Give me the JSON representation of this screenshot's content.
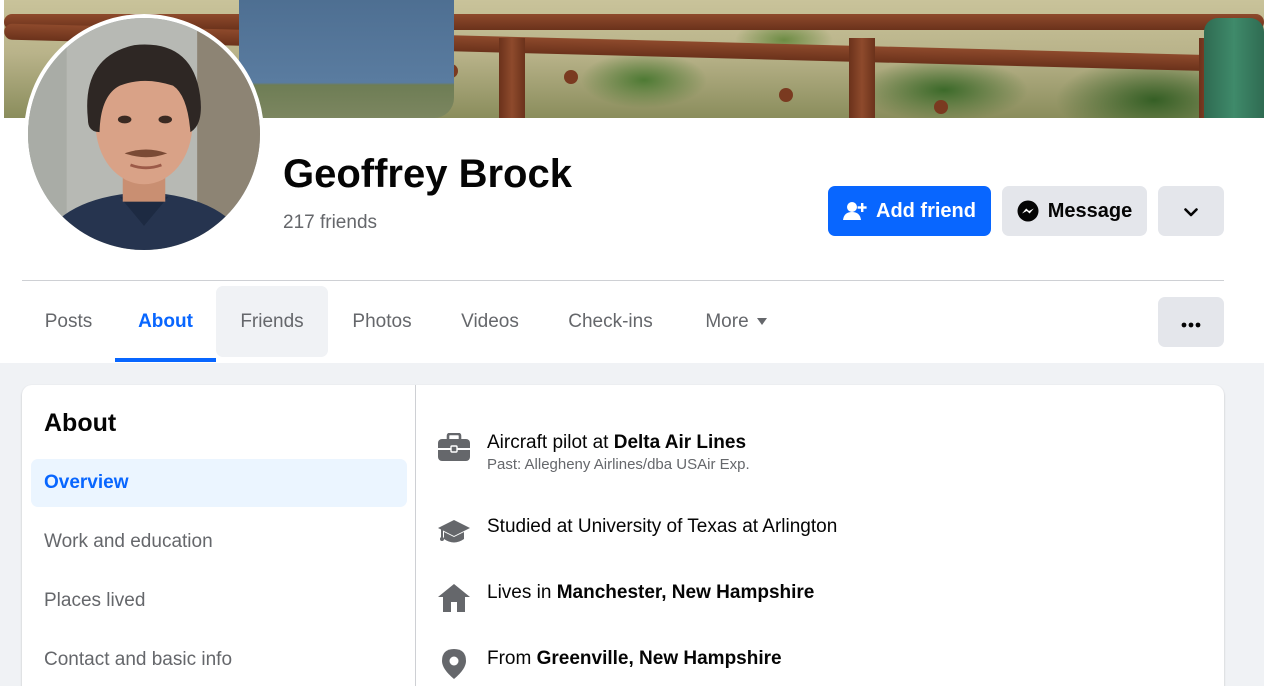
{
  "profile": {
    "name": "Geoffrey Brock",
    "friends_count": "217 friends"
  },
  "actions": {
    "add_friend": "Add friend",
    "message": "Message"
  },
  "tabs": [
    {
      "label": "Posts"
    },
    {
      "label": "About"
    },
    {
      "label": "Friends"
    },
    {
      "label": "Photos"
    },
    {
      "label": "Videos"
    },
    {
      "label": "Check-ins"
    },
    {
      "label": "More"
    }
  ],
  "about": {
    "title": "About",
    "nav": [
      {
        "label": "Overview"
      },
      {
        "label": "Work and education"
      },
      {
        "label": "Places lived"
      },
      {
        "label": "Contact and basic info"
      }
    ],
    "work": {
      "prefix": "Aircraft pilot at ",
      "employer": "Delta Air Lines",
      "past": "Past: Allegheny Airlines/dba USAir Exp."
    },
    "education": {
      "text": "Studied at University of Texas at Arlington"
    },
    "lives": {
      "prefix": "Lives in ",
      "place": "Manchester, New Hampshire"
    },
    "from": {
      "prefix": "From ",
      "place": "Greenville, New Hampshire"
    }
  },
  "colors": {
    "accent": "#0866ff",
    "secondary_button": "#e4e6eb",
    "muted_text": "#65676b",
    "page_background": "#f0f2f5"
  },
  "icons": {
    "add_friend": "person-plus-icon",
    "message": "messenger-icon",
    "chevron": "chevron-down-icon",
    "more_options": "ellipsis-icon",
    "work": "briefcase-icon",
    "education": "graduation-cap-icon",
    "lives": "house-icon",
    "from": "location-pin-icon"
  }
}
